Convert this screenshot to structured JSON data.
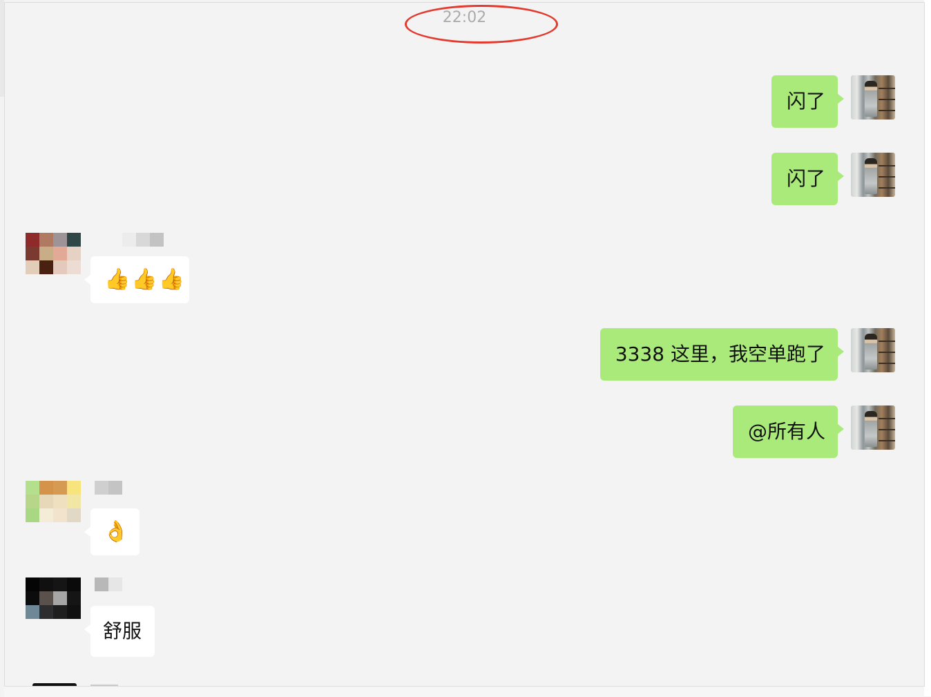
{
  "conversation": {
    "timestamp": "22:02",
    "messages": [
      {
        "direction": "outgoing",
        "text": "闪了"
      },
      {
        "direction": "outgoing",
        "text": "闪了"
      },
      {
        "direction": "incoming",
        "text": "👍👍👍"
      },
      {
        "direction": "outgoing",
        "text": "3338 这里，我空单跑了"
      },
      {
        "direction": "outgoing",
        "text": "@所有人"
      },
      {
        "direction": "incoming",
        "text": "👌"
      },
      {
        "direction": "incoming",
        "text": "舒服"
      }
    ]
  },
  "colors": {
    "outgoing_bubble": "#a9ea7a",
    "incoming_bubble": "#ffffff",
    "background": "#f3f3f3",
    "timestamp_text": "#ababab",
    "highlight_ring": "#e23a2e"
  },
  "icons": {
    "thumbs_up": "thumbs-up-emoji",
    "ok_hand": "ok-hand-emoji"
  }
}
